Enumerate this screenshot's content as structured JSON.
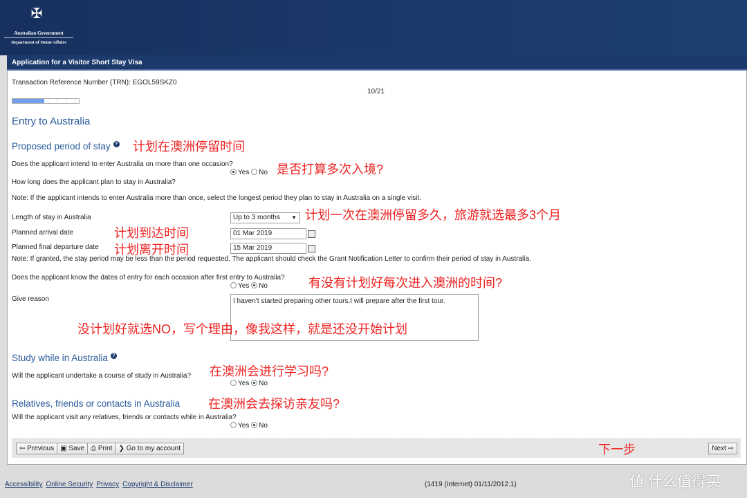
{
  "header": {
    "gov": "Australian Government",
    "dept": "Department of Home Affairs"
  },
  "title": "Application for a Visitor Short Stay Visa",
  "trn": "Transaction Reference Number (TRN): EGOL59SKZ0",
  "page_indicator": "10/21",
  "progress": 0.476,
  "page_title": "Entry to Australia",
  "s1": {
    "heading": "Proposed period of stay",
    "note_cn": "计划在澳洲停留时间",
    "q1": "Does the applicant intend to enter Australia on more than one occasion?",
    "q1_cn": "是否打算多次入境?",
    "q1_value": "Yes",
    "q2": "How long does the applicant plan to stay in Australia?",
    "note1": "Note: If the applicant intends to enter Australia more than once, select the longest period they plan to stay in Australia on a single visit.",
    "length_label": "Length of stay in Australia",
    "length_value": "Up to 3 months",
    "length_cn": "计划一次在澳洲停留多久，旅游就选最多3个月",
    "arrival_label": "Planned arrival date",
    "arrival_value": "01 Mar 2019",
    "arrival_cn": "计划到达时间",
    "departure_label": "Planned final departure date",
    "departure_value": "15 Mar 2019",
    "departure_cn": "计划离开时间",
    "note2": "Note: If granted, the stay period may be less than the period requested. The applicant should check the Grant Notification Letter to confirm their period of stay in Australia.",
    "q3": "Does the applicant know the dates of entry for each occasion after first entry to Australia?",
    "q3_cn": "有没有计划好每次进入澳洲的时间?",
    "q3_value": "No",
    "reason_label": "Give reason",
    "reason_value": "I haven't started preparing other tours.I will prepare after the first tour.",
    "reason_cn": "没计划好就选NO，写个理由，像我这样，就是还没开始计划"
  },
  "s2": {
    "heading": "Study while in Australia",
    "q": "Will the applicant undertake a course of study in Australia?",
    "cn": "在澳洲会进行学习吗?",
    "value": "No"
  },
  "s3": {
    "heading": "Relatives, friends or contacts in Australia",
    "q": "Will the applicant visit any relatives, friends or contacts while in Australia?",
    "cn": "在澳洲会去探访亲友吗?",
    "value": "No"
  },
  "yes": "Yes",
  "no": "No",
  "buttons": {
    "previous": "Previous",
    "save": "Save",
    "print": "Print",
    "account": "Go to my account",
    "next": "Next",
    "next_cn": "下一步"
  },
  "footer": {
    "links": [
      "Accessibility",
      "Online Security",
      "Privacy",
      "Copyright & Disclaimer"
    ],
    "version": "(1419 (Internet) 01/11/2012.1)"
  },
  "watermark": "什么值得买",
  "colors": {
    "navy": "#1b3a6b",
    "accent": "#2a5a9a",
    "annotation": "#ee2222"
  }
}
